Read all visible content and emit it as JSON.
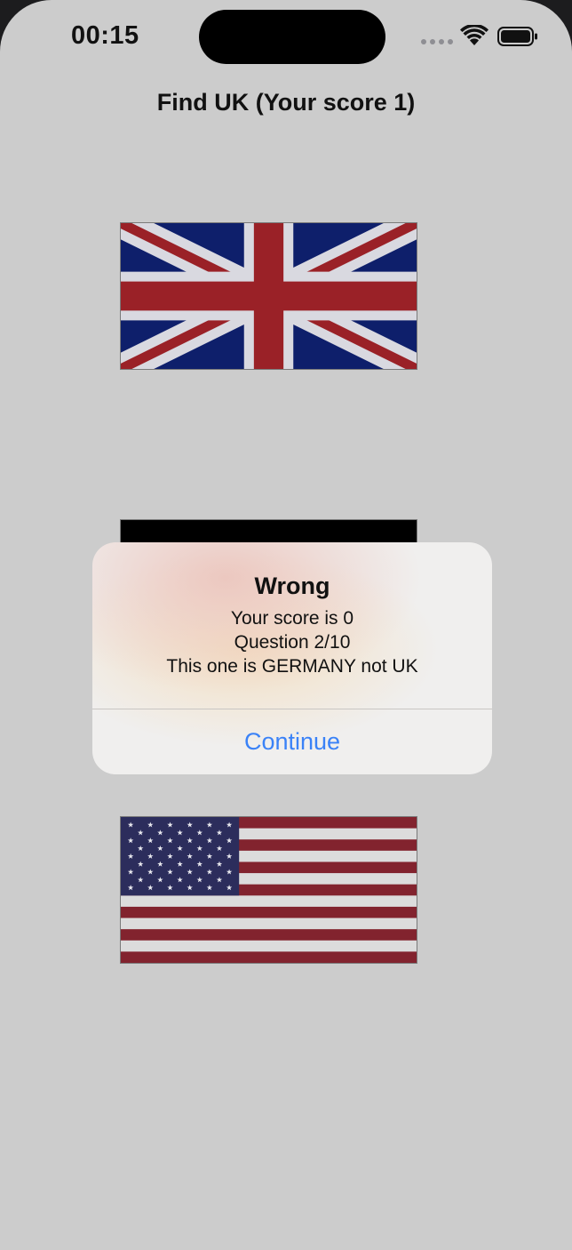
{
  "status_bar": {
    "time": "00:15",
    "signal_icon": "cellular-signal-icon",
    "wifi_icon": "wifi-icon",
    "battery_icon": "battery-icon"
  },
  "game": {
    "title": "Find UK (Your score 1)",
    "flags": [
      {
        "country": "UK",
        "icon": "uk-flag-icon"
      },
      {
        "country": "GERMANY",
        "icon": "germany-flag-icon"
      },
      {
        "country": "USA",
        "icon": "us-flag-icon"
      }
    ]
  },
  "alert": {
    "title": "Wrong",
    "lines": [
      "Your score is 0",
      "Question 2/10",
      "This one is GERMANY not UK"
    ],
    "button_label": "Continue"
  },
  "colors": {
    "background": "#cccccc",
    "accent": "#3a82f7",
    "uk_blue": "#0e1f6b",
    "uk_red": "#9a2127",
    "us_blue": "#2c2d5c",
    "us_red": "#82232e"
  }
}
